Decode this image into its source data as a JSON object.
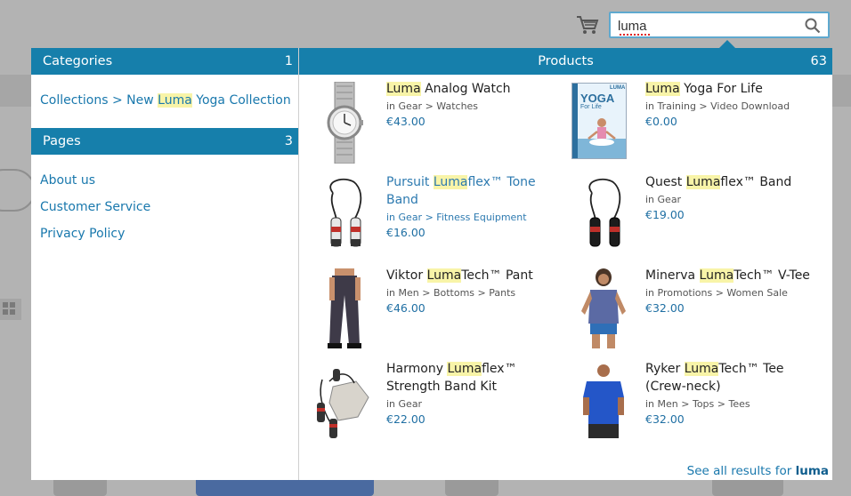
{
  "search": {
    "query": "luma"
  },
  "categories": {
    "title": "Categories",
    "count": "1",
    "items": [
      {
        "prefix": "Collections > New ",
        "highlight": "Luma",
        "suffix": " Yoga Collection"
      }
    ]
  },
  "pages": {
    "title": "Pages",
    "count": "3",
    "items": [
      "About us",
      "Customer Service",
      "Privacy Policy"
    ]
  },
  "products": {
    "title": "Products",
    "count": "63",
    "items": [
      {
        "pre": "",
        "highlight": "Luma",
        "post": " Analog Watch",
        "category": "in Gear > Watches",
        "price": "€43.00",
        "image": "watch"
      },
      {
        "pre": "",
        "highlight": "Luma",
        "post": " Yoga For Life",
        "category": "in Training > Video Download",
        "price": "€0.00",
        "image": "dvd"
      },
      {
        "pre": "Pursuit ",
        "highlight": "Luma",
        "post": "flex™ Tone Band",
        "category": "in Gear > Fitness Equipment",
        "price": "€16.00",
        "image": "jump-rope"
      },
      {
        "pre": "Quest ",
        "highlight": "Luma",
        "post": "flex™ Band",
        "category": "in Gear",
        "price": "€19.00",
        "image": "jump-rope"
      },
      {
        "pre": "Viktor ",
        "highlight": "Luma",
        "post": "Tech™ Pant",
        "category": "in Men > Bottoms > Pants",
        "price": "€46.00",
        "image": "pants"
      },
      {
        "pre": "Minerva ",
        "highlight": "Luma",
        "post": "Tech™ V-Tee",
        "category": "in Promotions > Women Sale",
        "price": "€32.00",
        "image": "woman-tee"
      },
      {
        "pre": "Harmony ",
        "highlight": "Luma",
        "post": "flex™ Strength Band Kit",
        "category": "in Gear",
        "price": "€22.00",
        "image": "band-kit"
      },
      {
        "pre": "Ryker ",
        "highlight": "Luma",
        "post": "Tech™ Tee (Crew-neck)",
        "category": "in Men > Tops > Tees",
        "price": "€32.00",
        "image": "man-tee"
      }
    ]
  },
  "dvd_cover": {
    "title": "YOGA",
    "subtitle": "For Life",
    "brand": "LUMA"
  },
  "see_all": {
    "text": "See all results for ",
    "term": "luma"
  },
  "colors": {
    "header": "#167fab",
    "link": "#1978ad",
    "highlight": "#f8f4a8"
  }
}
